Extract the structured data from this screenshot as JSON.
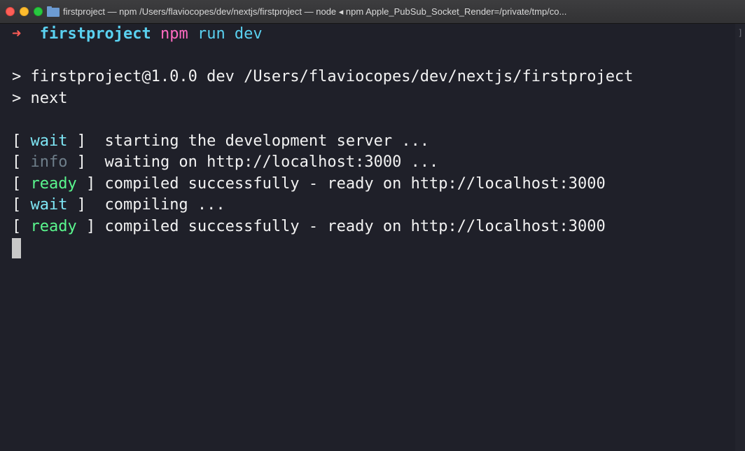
{
  "window": {
    "title": "firstproject — npm  /Users/flaviocopes/dev/nextjs/firstproject — node ◂ npm Apple_PubSub_Socket_Render=/private/tmp/co..."
  },
  "prompt": {
    "arrow": "➜",
    "directory": "firstproject",
    "command_bin": "npm",
    "command_args": "run dev"
  },
  "output": {
    "script_line": "> firstproject@1.0.0 dev /Users/flaviocopes/dev/nextjs/firstproject",
    "next_line": "> next",
    "logs": [
      {
        "tag": "wait",
        "pad": "  ",
        "message": "  starting the development server ..."
      },
      {
        "tag": "info",
        "pad": "  ",
        "message": "  waiting on http://localhost:3000 ..."
      },
      {
        "tag": "ready",
        "pad": " ",
        "message": " compiled successfully - ready on http://localhost:3000"
      },
      {
        "tag": "wait",
        "pad": "  ",
        "message": "  compiling ..."
      },
      {
        "tag": "ready",
        "pad": " ",
        "message": " compiled successfully - ready on http://localhost:3000"
      }
    ]
  },
  "colors": {
    "background": "#1f2029",
    "wait": "#7ee6f5",
    "info": "#6f7f8b",
    "ready": "#5af78e",
    "npm": "#ff6ac1",
    "arrow": "#ff5c57"
  },
  "icons": {
    "close": "close-button",
    "minimize": "minimize-button",
    "maximize": "maximize-button",
    "folder": "folder-icon"
  }
}
